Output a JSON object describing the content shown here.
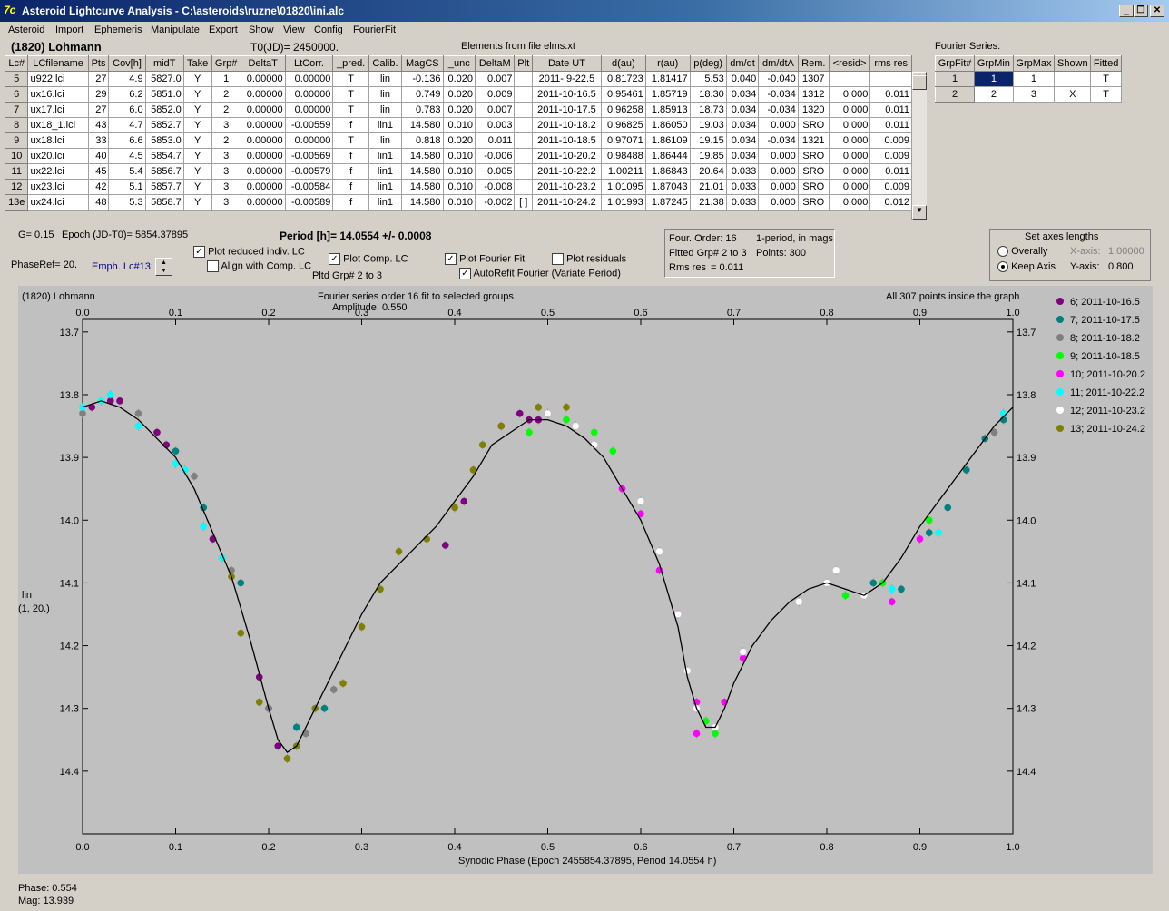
{
  "window": {
    "title": "Asteroid Lightcurve Analysis - C:\\asteroids\\ruzne\\01820\\ini.alc",
    "icon_text": "7c"
  },
  "menu": [
    "Asteroid",
    "Import",
    "Ephemeris",
    "Manipulate",
    "Export",
    "Show",
    "View",
    "Config",
    "FourierFit"
  ],
  "header": {
    "asteroid": "(1820) Lohmann",
    "t0": "T0(JD)= 2450000.",
    "elements": "Elements from file elms.xt"
  },
  "table": {
    "columns": [
      "Lc#",
      "LCfilename",
      "Pts",
      "Cov[h]",
      "midT",
      "Take",
      "Grp#",
      "DeltaT",
      "LtCorr.",
      "_pred.",
      "Calib.",
      "MagCS",
      "_unc",
      "DeltaM",
      "Plt",
      "Date UT",
      "d(au)",
      "r(au)",
      "p(deg)",
      "dm/dt",
      "dm/dtA",
      "Rem.",
      "<resid>",
      "rms res"
    ],
    "rows": [
      [
        "5",
        "u922.lci",
        "27",
        "4.9",
        "5827.0",
        "Y",
        "1",
        "0.00000",
        "0.00000",
        "T",
        "lin",
        "-0.136",
        "0.020",
        "0.007",
        "",
        "2011- 9-22.5",
        "0.81723",
        "1.81417",
        "5.53",
        "0.040",
        "-0.040",
        "1307",
        "",
        ""
      ],
      [
        "6",
        "ux16.lci",
        "29",
        "6.2",
        "5851.0",
        "Y",
        "2",
        "0.00000",
        "0.00000",
        "T",
        "lin",
        "0.749",
        "0.020",
        "0.009",
        "",
        "2011-10-16.5",
        "0.95461",
        "1.85719",
        "18.30",
        "0.034",
        "-0.034",
        "1312",
        "0.000",
        "0.011"
      ],
      [
        "7",
        "ux17.lci",
        "27",
        "6.0",
        "5852.0",
        "Y",
        "2",
        "0.00000",
        "0.00000",
        "T",
        "lin",
        "0.783",
        "0.020",
        "0.007",
        "",
        "2011-10-17.5",
        "0.96258",
        "1.85913",
        "18.73",
        "0.034",
        "-0.034",
        "1320",
        "0.000",
        "0.011"
      ],
      [
        "8",
        "ux18_1.lci",
        "43",
        "4.7",
        "5852.7",
        "Y",
        "3",
        "0.00000",
        "-0.00559",
        "f",
        "lin1",
        "14.580",
        "0.010",
        "0.003",
        "",
        "2011-10-18.2",
        "0.96825",
        "1.86050",
        "19.03",
        "0.034",
        "0.000",
        "SRO",
        "0.000",
        "0.011"
      ],
      [
        "9",
        "ux18.lci",
        "33",
        "6.6",
        "5853.0",
        "Y",
        "2",
        "0.00000",
        "0.00000",
        "T",
        "lin",
        "0.818",
        "0.020",
        "0.011",
        "",
        "2011-10-18.5",
        "0.97071",
        "1.86109",
        "19.15",
        "0.034",
        "-0.034",
        "1321",
        "0.000",
        "0.009"
      ],
      [
        "10",
        "ux20.lci",
        "40",
        "4.5",
        "5854.7",
        "Y",
        "3",
        "0.00000",
        "-0.00569",
        "f",
        "lin1",
        "14.580",
        "0.010",
        "-0.006",
        "",
        "2011-10-20.2",
        "0.98488",
        "1.86444",
        "19.85",
        "0.034",
        "0.000",
        "SRO",
        "0.000",
        "0.009"
      ],
      [
        "11",
        "ux22.lci",
        "45",
        "5.4",
        "5856.7",
        "Y",
        "3",
        "0.00000",
        "-0.00579",
        "f",
        "lin1",
        "14.580",
        "0.010",
        "0.005",
        "",
        "2011-10-22.2",
        "1.00211",
        "1.86843",
        "20.64",
        "0.033",
        "0.000",
        "SRO",
        "0.000",
        "0.011"
      ],
      [
        "12",
        "ux23.lci",
        "42",
        "5.1",
        "5857.7",
        "Y",
        "3",
        "0.00000",
        "-0.00584",
        "f",
        "lin1",
        "14.580",
        "0.010",
        "-0.008",
        "",
        "2011-10-23.2",
        "1.01095",
        "1.87043",
        "21.01",
        "0.033",
        "0.000",
        "SRO",
        "0.000",
        "0.009"
      ],
      [
        "13e",
        "ux24.lci",
        "48",
        "5.3",
        "5858.7",
        "Y",
        "3",
        "0.00000",
        "-0.00589",
        "f",
        "lin1",
        "14.580",
        "0.010",
        "-0.002",
        "[ ]",
        "2011-10-24.2",
        "1.01993",
        "1.87245",
        "21.38",
        "0.033",
        "0.000",
        "SRO",
        "0.000",
        "0.012"
      ]
    ]
  },
  "fourier": {
    "title": "Fourier Series:",
    "columns": [
      "GrpFit#",
      "GrpMin",
      "GrpMax",
      "Shown",
      "Fitted"
    ],
    "rows": [
      [
        "1",
        "1",
        "1",
        "",
        "T"
      ],
      [
        "2",
        "2",
        "3",
        "X",
        "T"
      ]
    ]
  },
  "controls": {
    "g": "G= 0.15",
    "epoch": "Epoch (JD-T0)= 5854.37895",
    "period": "Period [h]= 14.0554 +/- 0.0008",
    "phase_ref": "PhaseRef= 20.",
    "emph": "Emph. Lc#13:",
    "cb_reduced": "Plot reduced indiv. LC",
    "cb_align": "Align with Comp. LC",
    "cb_comp": "Plot Comp. LC",
    "pltd": "Pltd Grp#  2   to    3",
    "cb_fourier": "Plot Fourier Fit",
    "cb_resid": "Plot residuals",
    "cb_autorefit": "AutoRefit Fourier (Variate Period)",
    "fit_info": [
      "Four. Order: 16",
      "1-period, in mags",
      "Fitted Grp# 2 to 3",
      "Points: 300",
      "Rms res",
      "= 0.011"
    ],
    "axes_title": "Set axes lengths",
    "overally": "Overally",
    "keep_axis": "Keep Axis",
    "xaxis_label": "X-axis:",
    "xaxis_val": "1.00000",
    "yaxis_label": "Y-axis:",
    "yaxis_val": "0.800"
  },
  "graph": {
    "top_left": "(1820) Lohmann",
    "top_center": "Fourier series order 16 fit to selected groups",
    "amplitude": "Amplitude: 0.550",
    "top_right": "All 307 points inside the graph",
    "ylabel": [
      "lin",
      "(1, 20.)"
    ],
    "xlabel": "Synodic Phase (Epoch 2455854.37895, Period 14.0554 h)"
  },
  "status": {
    "phase": "Phase:  0.554",
    "mag": "Mag:   13.939"
  },
  "chart_data": {
    "type": "scatter",
    "xlim": [
      0,
      1
    ],
    "ylim": [
      14.5,
      13.68
    ],
    "x_ticks": [
      "0.0",
      "0.1",
      "0.2",
      "0.3",
      "0.4",
      "0.5",
      "0.6",
      "0.7",
      "0.8",
      "0.9",
      "1.0"
    ],
    "y_ticks": [
      "13.7",
      "13.8",
      "13.9",
      "14.0",
      "14.1",
      "14.2",
      "14.3",
      "14.4"
    ],
    "legend_position": "right",
    "series": [
      {
        "name": "6; 2011-10-16.5",
        "color": "#800080",
        "points": [
          [
            0.01,
            13.82
          ],
          [
            0.03,
            13.81
          ],
          [
            0.04,
            13.81
          ],
          [
            0.08,
            13.86
          ],
          [
            0.09,
            13.88
          ],
          [
            0.14,
            14.03
          ],
          [
            0.19,
            14.25
          ],
          [
            0.2,
            14.3
          ],
          [
            0.21,
            14.36
          ],
          [
            0.39,
            14.04
          ],
          [
            0.41,
            13.97
          ],
          [
            0.45,
            13.85
          ],
          [
            0.47,
            13.83
          ],
          [
            0.48,
            13.84
          ],
          [
            0.49,
            13.84
          ],
          [
            0.5,
            13.83
          ]
        ]
      },
      {
        "name": "7; 2011-10-17.5",
        "color": "#008080",
        "points": [
          [
            0.1,
            13.89
          ],
          [
            0.13,
            13.98
          ],
          [
            0.17,
            14.1
          ],
          [
            0.23,
            14.33
          ],
          [
            0.26,
            14.3
          ],
          [
            0.88,
            14.11
          ],
          [
            0.91,
            14.02
          ],
          [
            0.93,
            13.98
          ],
          [
            0.95,
            13.92
          ],
          [
            0.97,
            13.87
          ],
          [
            0.99,
            13.84
          ],
          [
            0.85,
            14.1
          ]
        ]
      },
      {
        "name": "8; 2011-10-18.2",
        "color": "#808080",
        "points": [
          [
            0.0,
            13.83
          ],
          [
            0.06,
            13.83
          ],
          [
            0.12,
            13.93
          ],
          [
            0.16,
            14.08
          ],
          [
            0.2,
            14.3
          ],
          [
            0.22,
            14.38
          ],
          [
            0.24,
            14.34
          ],
          [
            0.27,
            14.27
          ],
          [
            0.98,
            13.86
          ]
        ]
      },
      {
        "name": "9; 2011-10-18.5",
        "color": "#00ff00",
        "points": [
          [
            0.48,
            13.86
          ],
          [
            0.52,
            13.84
          ],
          [
            0.55,
            13.86
          ],
          [
            0.57,
            13.89
          ],
          [
            0.67,
            14.32
          ],
          [
            0.68,
            14.34
          ],
          [
            0.82,
            14.12
          ],
          [
            0.86,
            14.1
          ],
          [
            0.91,
            14.0
          ]
        ]
      },
      {
        "name": "10; 2011-10-20.2",
        "color": "#ff00ff",
        "points": [
          [
            0.58,
            13.95
          ],
          [
            0.6,
            13.99
          ],
          [
            0.62,
            14.08
          ],
          [
            0.64,
            14.15
          ],
          [
            0.66,
            14.29
          ],
          [
            0.66,
            14.34
          ],
          [
            0.69,
            14.29
          ],
          [
            0.71,
            14.22
          ],
          [
            0.87,
            14.13
          ],
          [
            0.9,
            14.03
          ]
        ]
      },
      {
        "name": "11; 2011-10-22.2",
        "color": "#00ffff",
        "points": [
          [
            0.0,
            13.82
          ],
          [
            0.02,
            13.81
          ],
          [
            0.03,
            13.8
          ],
          [
            0.06,
            13.85
          ],
          [
            0.1,
            13.91
          ],
          [
            0.11,
            13.92
          ],
          [
            0.13,
            14.01
          ],
          [
            0.15,
            14.06
          ],
          [
            0.87,
            14.11
          ],
          [
            0.92,
            14.02
          ],
          [
            0.99,
            13.83
          ]
        ]
      },
      {
        "name": "12; 2011-10-23.2",
        "color": "#ffffff",
        "points": [
          [
            0.5,
            13.83
          ],
          [
            0.53,
            13.85
          ],
          [
            0.55,
            13.88
          ],
          [
            0.6,
            13.97
          ],
          [
            0.62,
            14.05
          ],
          [
            0.64,
            14.15
          ],
          [
            0.65,
            14.24
          ],
          [
            0.66,
            14.3
          ],
          [
            0.68,
            14.33
          ],
          [
            0.71,
            14.21
          ],
          [
            0.77,
            14.13
          ],
          [
            0.8,
            14.1
          ],
          [
            0.81,
            14.08
          ],
          [
            0.84,
            14.12
          ]
        ]
      },
      {
        "name": "13; 2011-10-24.2",
        "color": "#808000",
        "points": [
          [
            0.16,
            14.09
          ],
          [
            0.17,
            14.18
          ],
          [
            0.19,
            14.29
          ],
          [
            0.22,
            14.38
          ],
          [
            0.23,
            14.36
          ],
          [
            0.25,
            14.3
          ],
          [
            0.28,
            14.26
          ],
          [
            0.3,
            14.17
          ],
          [
            0.32,
            14.11
          ],
          [
            0.34,
            14.05
          ],
          [
            0.37,
            14.03
          ],
          [
            0.4,
            13.98
          ],
          [
            0.42,
            13.92
          ],
          [
            0.43,
            13.88
          ],
          [
            0.45,
            13.85
          ],
          [
            0.49,
            13.82
          ],
          [
            0.52,
            13.82
          ]
        ]
      }
    ],
    "fit_curve": [
      [
        0,
        13.82
      ],
      [
        0.02,
        13.81
      ],
      [
        0.04,
        13.82
      ],
      [
        0.06,
        13.84
      ],
      [
        0.08,
        13.87
      ],
      [
        0.1,
        13.9
      ],
      [
        0.12,
        13.95
      ],
      [
        0.14,
        14.02
      ],
      [
        0.16,
        14.09
      ],
      [
        0.18,
        14.19
      ],
      [
        0.2,
        14.3
      ],
      [
        0.21,
        14.35
      ],
      [
        0.22,
        14.37
      ],
      [
        0.23,
        14.36
      ],
      [
        0.24,
        14.33
      ],
      [
        0.26,
        14.27
      ],
      [
        0.28,
        14.21
      ],
      [
        0.3,
        14.15
      ],
      [
        0.32,
        14.1
      ],
      [
        0.34,
        14.07
      ],
      [
        0.36,
        14.04
      ],
      [
        0.38,
        14.01
      ],
      [
        0.4,
        13.97
      ],
      [
        0.42,
        13.93
      ],
      [
        0.44,
        13.88
      ],
      [
        0.46,
        13.86
      ],
      [
        0.48,
        13.84
      ],
      [
        0.5,
        13.84
      ],
      [
        0.52,
        13.85
      ],
      [
        0.54,
        13.87
      ],
      [
        0.56,
        13.9
      ],
      [
        0.58,
        13.95
      ],
      [
        0.6,
        14.0
      ],
      [
        0.62,
        14.07
      ],
      [
        0.64,
        14.17
      ],
      [
        0.65,
        14.25
      ],
      [
        0.66,
        14.3
      ],
      [
        0.67,
        14.33
      ],
      [
        0.68,
        14.33
      ],
      [
        0.69,
        14.3
      ],
      [
        0.7,
        14.26
      ],
      [
        0.72,
        14.2
      ],
      [
        0.74,
        14.16
      ],
      [
        0.76,
        14.13
      ],
      [
        0.78,
        14.11
      ],
      [
        0.8,
        14.1
      ],
      [
        0.82,
        14.11
      ],
      [
        0.84,
        14.12
      ],
      [
        0.86,
        14.1
      ],
      [
        0.88,
        14.06
      ],
      [
        0.9,
        14.01
      ],
      [
        0.92,
        13.97
      ],
      [
        0.94,
        13.93
      ],
      [
        0.96,
        13.89
      ],
      [
        0.98,
        13.85
      ],
      [
        1.0,
        13.82
      ]
    ]
  }
}
